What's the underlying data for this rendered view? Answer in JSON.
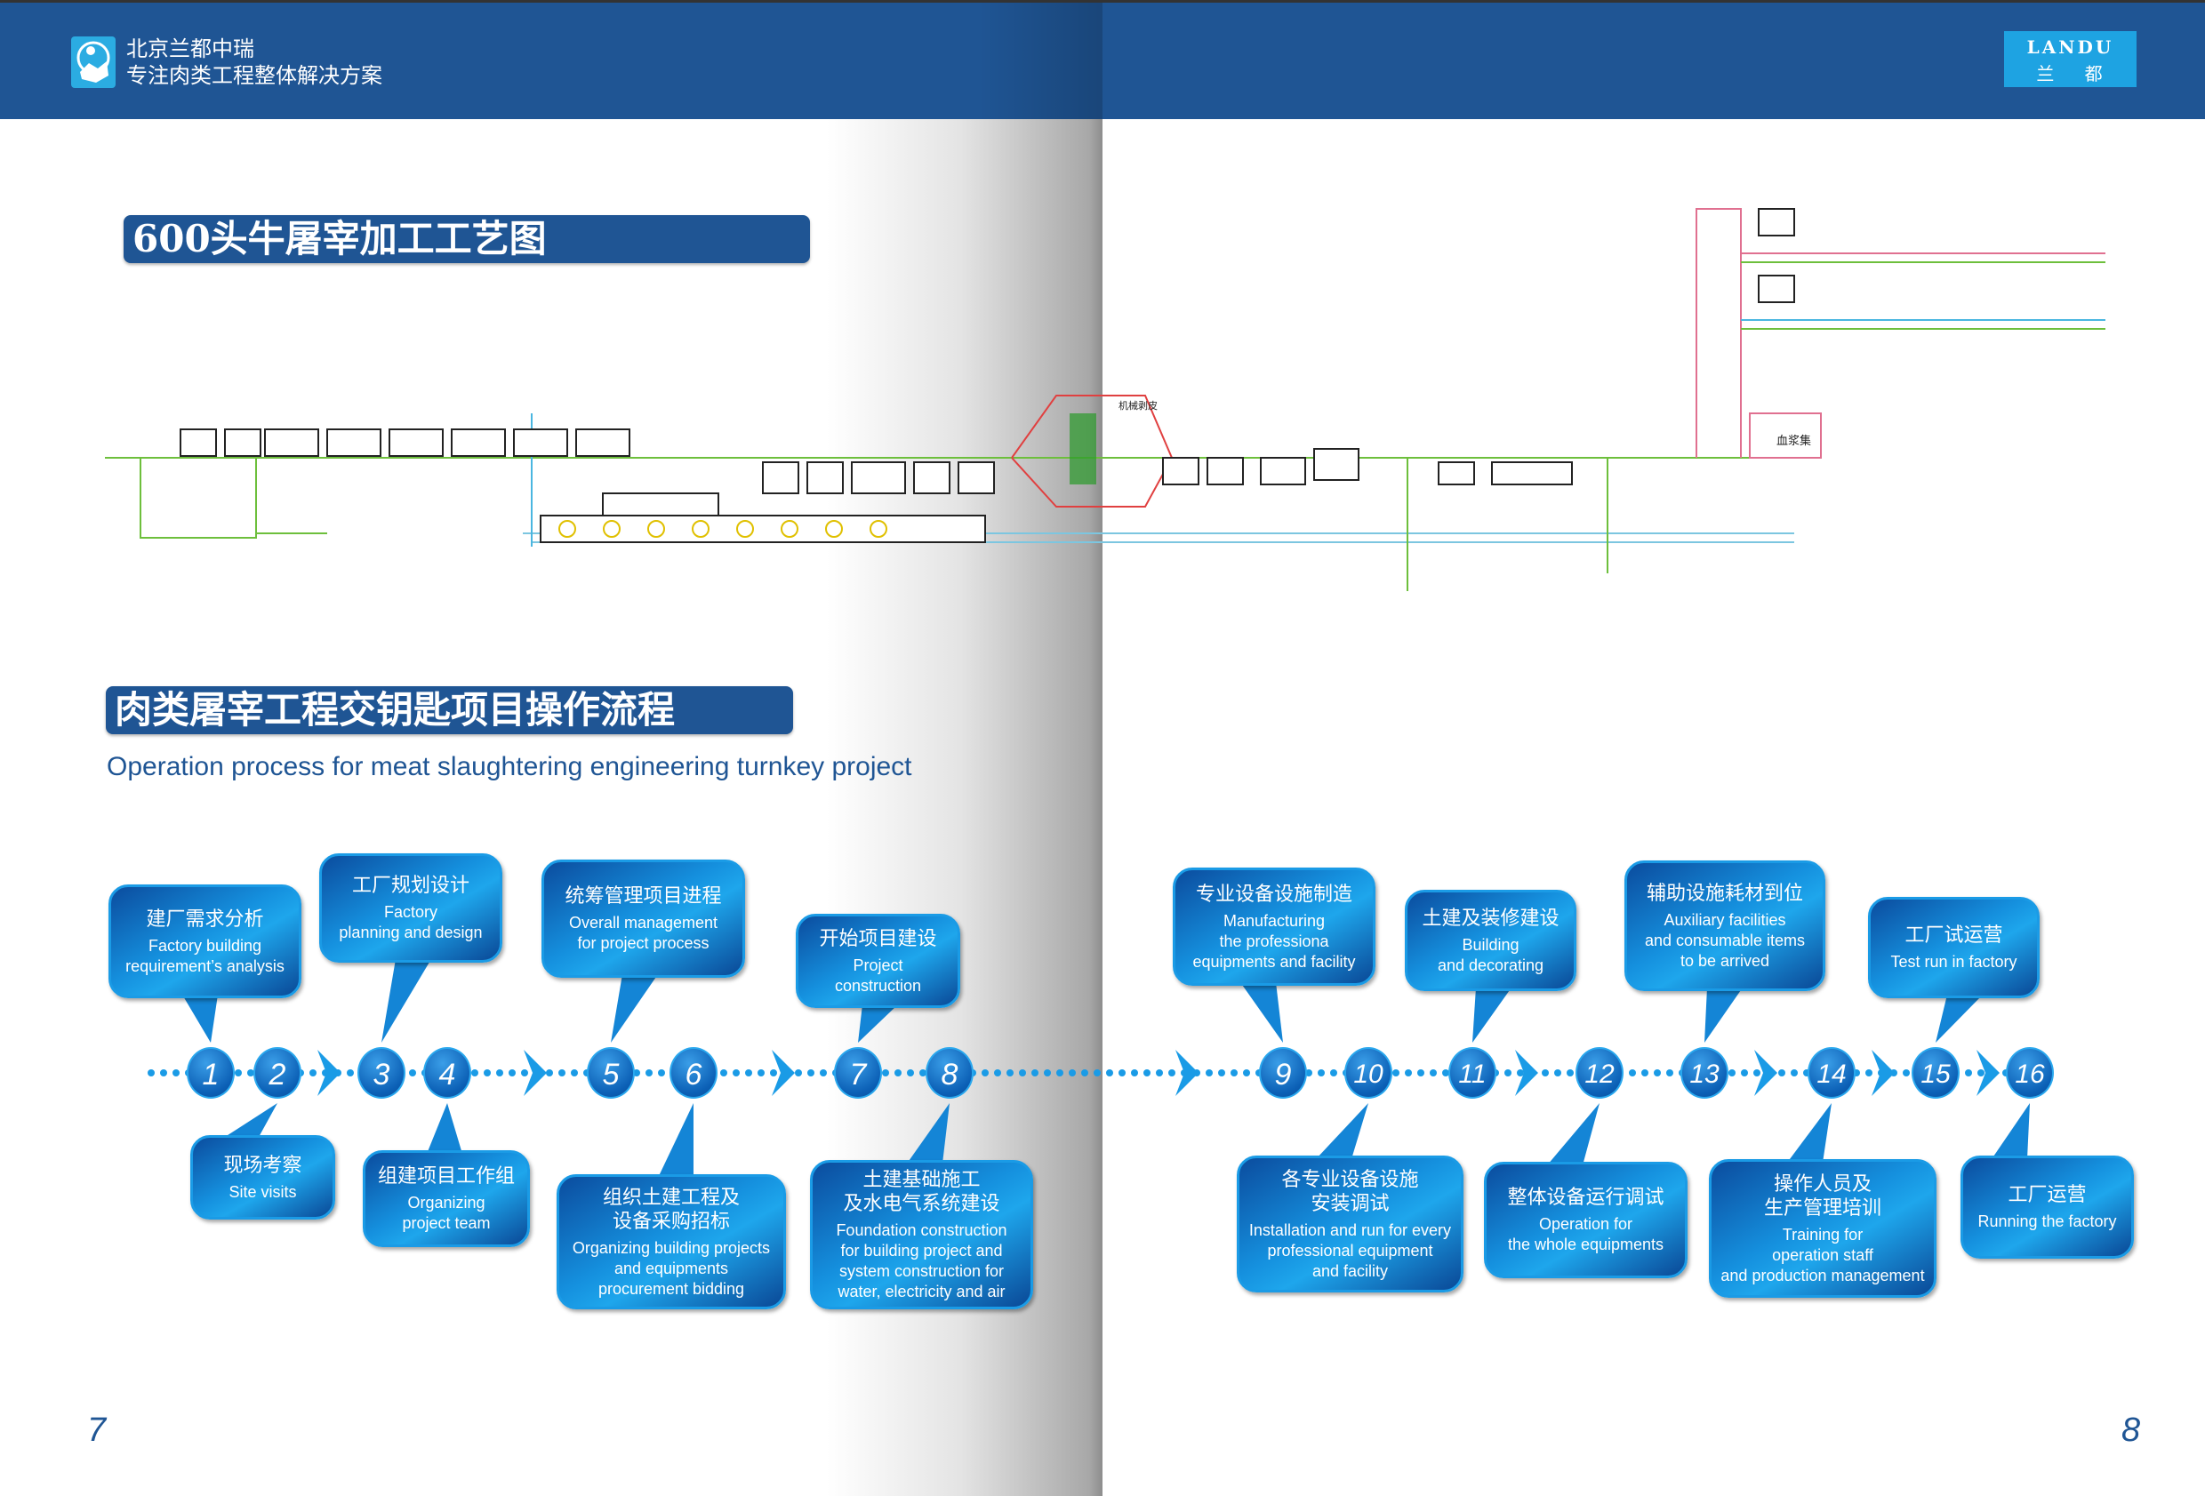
{
  "header": {
    "company": "北京兰都中瑞",
    "slogan": "专注肉类工程整体解决方案",
    "badge_en": "LANDU",
    "badge_zh": "兰 都"
  },
  "colors": {
    "brand": "#1f5594",
    "accent": "#1ea3e2",
    "flow_line": "#1a9be6"
  },
  "diagram": {
    "title": "600头牛屠宰加工工艺图",
    "labels": [
      "机械剥皮",
      "血浆集"
    ]
  },
  "process": {
    "title": "肉类屠宰工程交钥匙项目操作流程",
    "subtitle": "Operation process for meat slaughtering engineering turnkey project",
    "steps": [
      {
        "num": "1",
        "zh": [
          "建厂需求分析"
        ],
        "en": [
          "Factory building",
          "requirement’s analysis"
        ]
      },
      {
        "num": "2",
        "zh": [
          "现场考察"
        ],
        "en": [
          "Site visits"
        ]
      },
      {
        "num": "3",
        "zh": [
          "工厂规划设计"
        ],
        "en": [
          "Factory",
          "planning and design"
        ]
      },
      {
        "num": "4",
        "zh": [
          "组建项目工作组"
        ],
        "en": [
          "Organizing",
          "project team"
        ]
      },
      {
        "num": "5",
        "zh": [
          "统筹管理项目进程"
        ],
        "en": [
          "Overall management",
          "for project process"
        ]
      },
      {
        "num": "6",
        "zh": [
          "组织土建工程及",
          "设备采购招标"
        ],
        "en": [
          "Organizing building projects",
          "and equipments",
          "procurement bidding"
        ]
      },
      {
        "num": "7",
        "zh": [
          "开始项目建设"
        ],
        "en": [
          "Project",
          "construction"
        ]
      },
      {
        "num": "8",
        "zh": [
          "土建基础施工",
          "及水电气系统建设"
        ],
        "en": [
          "Foundation construction",
          "for building project  and",
          "system construction for",
          "water, electricity and air"
        ]
      },
      {
        "num": "9",
        "zh": [
          "专业设备设施制造"
        ],
        "en": [
          "Manufacturing",
          "the professiona",
          "equipments and facility"
        ]
      },
      {
        "num": "10",
        "zh": [
          "各专业设备设施",
          "安装调试"
        ],
        "en": [
          "Installation and run for every",
          "professional equipment",
          "and facility"
        ]
      },
      {
        "num": "11",
        "zh": [
          "土建及装修建设"
        ],
        "en": [
          "Building",
          "and decorating"
        ]
      },
      {
        "num": "12",
        "zh": [
          "整体设备运行调试"
        ],
        "en": [
          "Operation for",
          "the whole equipments"
        ]
      },
      {
        "num": "13",
        "zh": [
          "辅助设施耗材到位"
        ],
        "en": [
          "Auxiliary facilities",
          "and consumable items",
          "to be arrived"
        ]
      },
      {
        "num": "14",
        "zh": [
          "操作人员及",
          "生产管理培训"
        ],
        "en": [
          "Training for",
          "operation staff",
          "and production management"
        ]
      },
      {
        "num": "15",
        "zh": [
          "工厂试运营"
        ],
        "en": [
          "Test run in factory"
        ]
      },
      {
        "num": "16",
        "zh": [
          "工厂运营"
        ],
        "en": [
          "Running the factory"
        ]
      }
    ]
  },
  "pages": {
    "left": "7",
    "right": "8"
  }
}
